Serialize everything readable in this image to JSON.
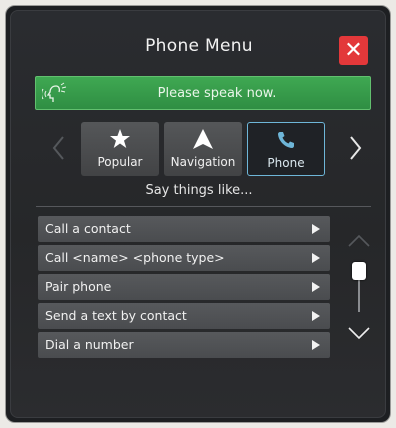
{
  "dialog": {
    "title": "Phone Menu",
    "close_label": "✕"
  },
  "speak_prompt": {
    "text": "Please speak now.",
    "icon": "speaking-head-icon",
    "color": "#3a9e4d"
  },
  "nav": {
    "left_arrow": "‹",
    "right_arrow": "›"
  },
  "categories": [
    {
      "label": "Popular",
      "icon": "star-icon",
      "selected": false
    },
    {
      "label": "Navigation",
      "icon": "navigation-arrow-icon",
      "selected": false
    },
    {
      "label": "Phone",
      "icon": "phone-icon",
      "selected": true
    }
  ],
  "hint": "Say things like...",
  "commands": [
    "Call a contact",
    "Call <name> <phone type>",
    "Pair phone",
    "Send a text by contact",
    "Dial a number"
  ],
  "colors": {
    "accent_selected": "#6eb6d8",
    "close": "#e3383a",
    "background": "#262729"
  }
}
